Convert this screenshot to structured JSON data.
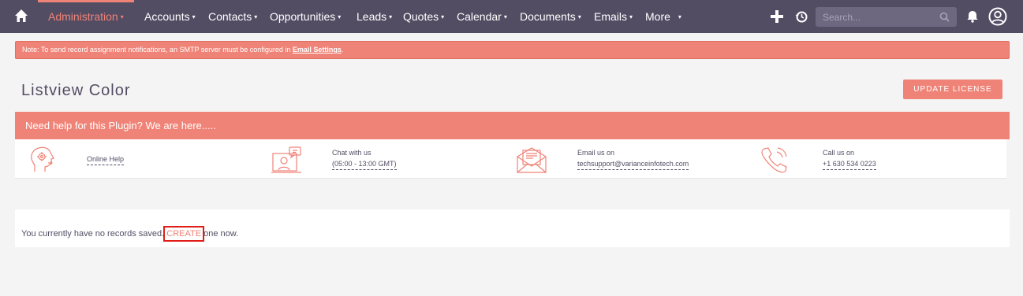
{
  "nav": {
    "items": [
      {
        "label": "Administration",
        "active": true
      },
      {
        "label": "Accounts"
      },
      {
        "label": "Contacts"
      },
      {
        "label": "Opportunities"
      },
      {
        "label": "Leads"
      },
      {
        "label": "Quotes"
      },
      {
        "label": "Calendar"
      },
      {
        "label": "Documents"
      },
      {
        "label": "Emails"
      },
      {
        "label": "More"
      }
    ],
    "caret": "▾",
    "search_placeholder": "Search..."
  },
  "notice": {
    "text": "Note: To send record assignment notifications, an SMTP server must be configured in ",
    "link": "Email Settings",
    "suffix": "."
  },
  "page": {
    "title": "Listview Color",
    "update_license": "UPDATE LICENSE"
  },
  "help": {
    "heading": "Need help for this Plugin? We are here.....",
    "online": {
      "label": "Online Help"
    },
    "chat": {
      "label": "Chat with us",
      "value": "(05:00 - 13:00 GMT)"
    },
    "email": {
      "label": "Email us on",
      "value": "techsupport@varianceinfotech.com"
    },
    "call": {
      "label": "Call us on",
      "value": "+1 630 534 0223"
    }
  },
  "empty": {
    "prefix": "You currently have no records saved. ",
    "create": "CREATE",
    "suffix": " one now."
  },
  "colors": {
    "accent": "#f08377",
    "navbar": "#534d64",
    "background": "#f5f4f4",
    "highlight_box": "#e11d17"
  }
}
